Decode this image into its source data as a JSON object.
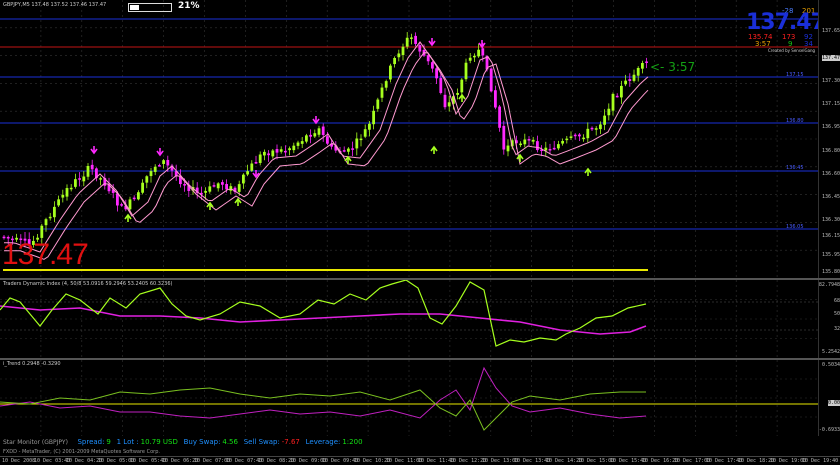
{
  "header": {
    "symbol_ohlc": "GBPJPY,M5  137.48 137.52 137.46 137.47",
    "spread_pct": "21%"
  },
  "info_box": {
    "price_big": "137.47",
    "top_values": [
      "-28",
      "201"
    ],
    "mid_values": [
      "135.74",
      "173",
      "92"
    ],
    "bot_values": [
      "3:57",
      "9",
      "34"
    ],
    "credit": "Created by SenselGang"
  },
  "price_labels": {
    "big_price": "137.47",
    "countdown": "<- 3:57"
  },
  "main_axis": {
    "ticks": [
      "137.65",
      "137.47",
      "137.30",
      "137.15",
      "136.95",
      "136.80",
      "136.60",
      "136.45",
      "136.30",
      "136.15",
      "135.95",
      "135.80"
    ]
  },
  "level_labels": [
    "137.15",
    "136.80",
    "136.45",
    "136.05"
  ],
  "indicator1": {
    "title": "Traders Dynamic Index (4, 50/8 53.0916 59.2946 53.2405 60.3236)",
    "ticks": [
      "82.7948",
      "68",
      "50",
      "32",
      "5.2542"
    ]
  },
  "indicator2": {
    "title": "i_Trend 0.2948 -0.3290",
    "ticks": [
      "0.5034",
      "0.00",
      "-0.6933"
    ]
  },
  "status_bar": {
    "line1_label": "Star Monitor (GBPJPY)",
    "spread_label": "Spread:",
    "spread_value": "9",
    "lot_label": "1 Lot :",
    "lot_value": "10.79 USD",
    "buy_swap_label": "Buy Swap:",
    "buy_swap_value": "4.56",
    "sell_swap_label": "Sell Swap:",
    "sell_swap_value": "-7.67",
    "leverage_label": "Leverage:",
    "leverage_value": "1:200",
    "line2": "FXDD - MetaTrader, (C) 2001-2009 MetaQuotes Software Corp."
  },
  "time_axis": [
    "10 Dec 2008",
    "10 Dec 03:40",
    "10 Dec 04:20",
    "10 Dec 05:00",
    "10 Dec 05:40",
    "10 Dec 06:20",
    "10 Dec 07:00",
    "10 Dec 07:40",
    "10 Dec 08:20",
    "10 Dec 09:00",
    "10 Dec 09:40",
    "10 Dec 10:20",
    "10 Dec 11:00",
    "10 Dec 11:40",
    "10 Dec 12:20",
    "10 Dec 13:00",
    "10 Dec 13:40",
    "10 Dec 14:20",
    "10 Dec 15:00",
    "10 Dec 15:40",
    "10 Dec 16:20",
    "10 Dec 17:00",
    "10 Dec 17:40",
    "10 Dec 18:20",
    "10 Dec 19:00",
    "10 Dec 19:40"
  ],
  "colors": {
    "bull_candle": "#a6ff1e",
    "bear_candle": "#ff29ff",
    "ma_line": "#ff9ad0",
    "blue_level": "#1a2fd8",
    "red_level": "#c21414",
    "yellow_level": "#e8e800",
    "big_price": "#e01010",
    "countdown": "#14a014"
  }
}
